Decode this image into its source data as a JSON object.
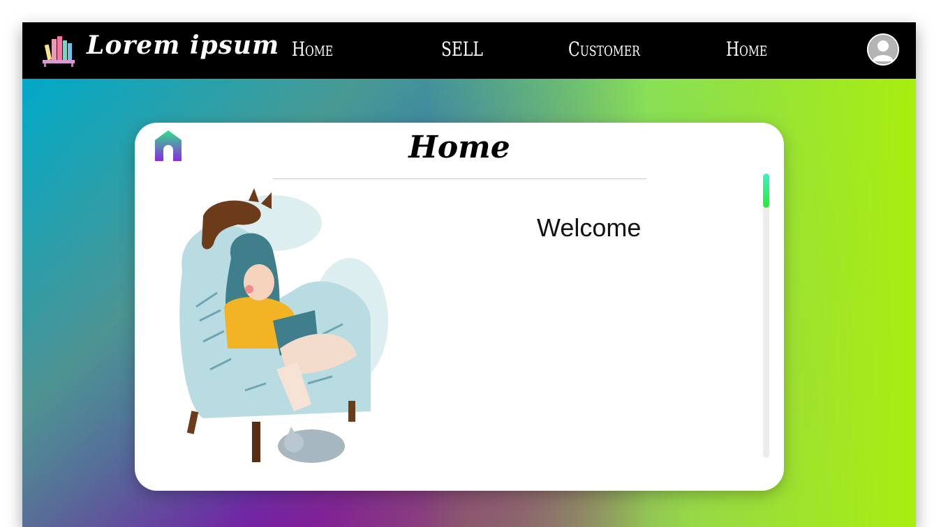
{
  "navbar": {
    "brand": "Lorem ipsum",
    "items": [
      {
        "label": "Home"
      },
      {
        "label": "SELL"
      },
      {
        "label": "Customer"
      },
      {
        "label": "Home"
      }
    ],
    "logo_icon": "bookshelf-icon",
    "avatar_icon": "user-avatar-icon"
  },
  "card": {
    "title": "Home",
    "welcome": "Welcome",
    "home_icon": "house-icon",
    "illustration": "girl-reading-in-armchair-with-cats"
  },
  "colors": {
    "navbar": "#000000",
    "card": "#ffffff",
    "gradient_blue": "#0097c8",
    "gradient_purple": "#8a00a8",
    "gradient_green": "#a8ee10",
    "scroll_thumb": "#22ee30"
  }
}
